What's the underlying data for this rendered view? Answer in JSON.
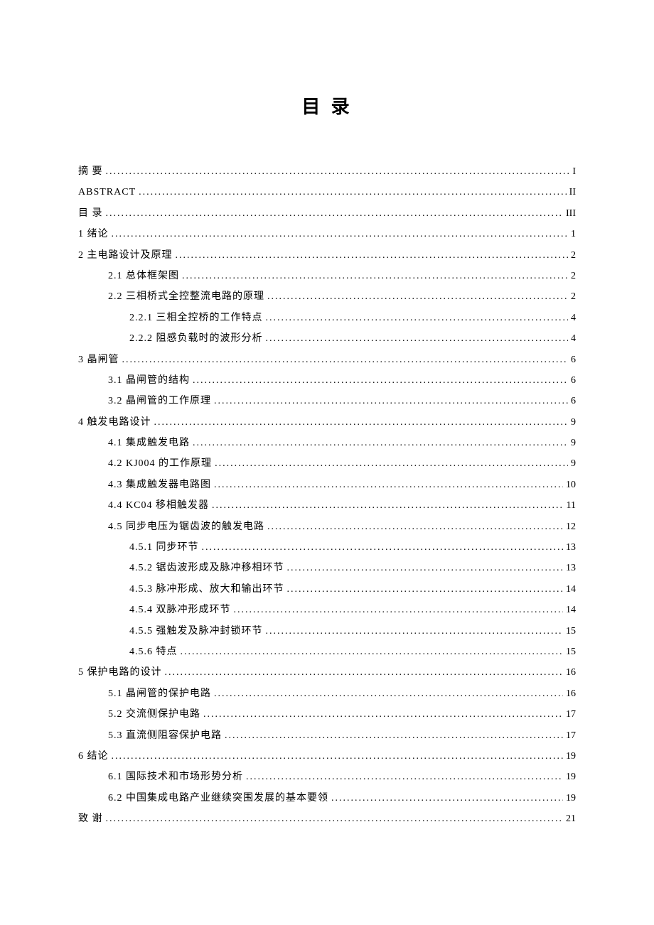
{
  "title": "目 录",
  "entries": [
    {
      "level": 0,
      "label": "摘 要",
      "page": "I"
    },
    {
      "level": 0,
      "label": "ABSTRACT",
      "page": "II"
    },
    {
      "level": 0,
      "label": "目 录",
      "page": "III"
    },
    {
      "level": 0,
      "label": "1 绪论",
      "page": "1"
    },
    {
      "level": 0,
      "label": "2 主电路设计及原理",
      "page": "2"
    },
    {
      "level": 1,
      "label": "2.1   总体框架图",
      "page": "2"
    },
    {
      "level": 1,
      "label": "2.2   三相桥式全控整流电路的原理",
      "page": "2"
    },
    {
      "level": 2,
      "label": "2.2.1 三相全控桥的工作特点",
      "page": "4"
    },
    {
      "level": 2,
      "label": "2.2.2 阻感负载时的波形分析",
      "page": "4"
    },
    {
      "level": 0,
      "label": "3  晶闸管",
      "page": "6"
    },
    {
      "level": 1,
      "label": "3.1 晶闸管的结构",
      "page": "6"
    },
    {
      "level": 1,
      "label": "3.2 晶闸管的工作原理",
      "page": "6"
    },
    {
      "level": 0,
      "label": "4  触发电路设计",
      "page": "9"
    },
    {
      "level": 1,
      "label": "4.1 集成触发电路",
      "page": "9"
    },
    {
      "level": 1,
      "label": "4.2 KJ004 的工作原理",
      "page": "9"
    },
    {
      "level": 1,
      "label": "4.3 集成触发器电路图",
      "page": "10"
    },
    {
      "level": 1,
      "label": "4.4 KC04 移相触发器",
      "page": "11"
    },
    {
      "level": 1,
      "label": "4.5 同步电压为锯齿波的触发电路",
      "page": "12"
    },
    {
      "level": 2,
      "label": "4.5.1 同步环节",
      "page": "13"
    },
    {
      "level": 2,
      "label": "4.5.2 锯齿波形成及脉冲移相环节",
      "page": "13"
    },
    {
      "level": 2,
      "label": "4.5.3 脉冲形成、放大和输出环节",
      "page": "14"
    },
    {
      "level": 2,
      "label": "4.5.4 双脉冲形成环节",
      "page": "14"
    },
    {
      "level": 2,
      "label": "4.5.5 强触发及脉冲封锁环节",
      "page": "15"
    },
    {
      "level": 2,
      "label": "4.5.6 特点",
      "page": "15"
    },
    {
      "level": 0,
      "label": "5  保护电路的设计",
      "page": "16"
    },
    {
      "level": 1,
      "label": "5.1 晶闸管的保护电路",
      "page": "16"
    },
    {
      "level": 1,
      "label": "5.2 交流侧保护电路",
      "page": "17"
    },
    {
      "level": 1,
      "label": "5.3 直流侧阻容保护电路",
      "page": "17"
    },
    {
      "level": 0,
      "label": "6 结论",
      "page": "19"
    },
    {
      "level": 1,
      "label": "6.1 国际技术和市场形势分析",
      "page": "19"
    },
    {
      "level": 1,
      "label": "6.2 中国集成电路产业继续突围发展的基本要领",
      "page": "19"
    },
    {
      "level": 0,
      "label": "致 谢",
      "page": "21"
    }
  ]
}
